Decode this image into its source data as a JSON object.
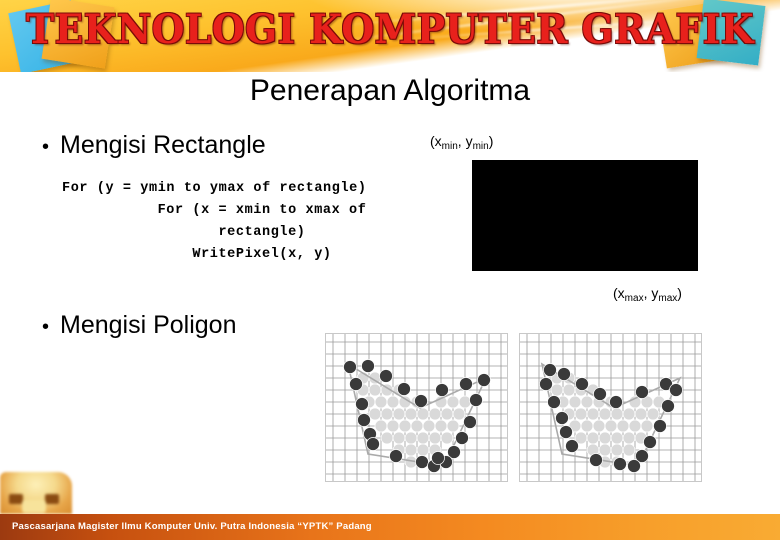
{
  "banner": {
    "title": "TEKNOLOGI KOMPUTER GRAFIK",
    "accent_red": "#e8211c",
    "accent_yellow": "#fec22e",
    "decor": [
      {
        "name": "blue-square-left",
        "color": "#43b8e8"
      },
      {
        "name": "orange-square-left",
        "color": "#f5b02c"
      },
      {
        "name": "orange-square-right",
        "color": "#f3a720"
      },
      {
        "name": "teal-square-right",
        "color": "#45b7c4"
      }
    ]
  },
  "slide": {
    "title": "Penerapan Algoritma",
    "bullets": [
      {
        "marker": "•",
        "label": "Mengisi Rectangle"
      },
      {
        "marker": "•",
        "label": "Mengisi Poligon"
      }
    ],
    "code": {
      "line1": "For (y = ymin to ymax of rectangle)",
      "line2": "For (x = xmin to xmax of",
      "line3": "rectangle)",
      "line4": "WritePixel(x, y)"
    },
    "rectangle_demo": {
      "fill_color": "#000000",
      "label_min_open": "(x",
      "label_min_sub1": "min",
      "label_min_mid": ", y",
      "label_min_sub2": "min",
      "label_min_close": ")",
      "label_max_open": "(x",
      "label_max_sub1": "max",
      "label_max_mid": ", y",
      "label_max_sub2": "max",
      "label_max_close": ")"
    },
    "polygon_figures": [
      {
        "name": "polygon-fill-figure-left",
        "grid_color": "#808080",
        "interior_pixel_color": "#d9d9d9",
        "boundary_pixel_color": "#404040"
      },
      {
        "name": "polygon-fill-figure-right",
        "grid_color": "#808080",
        "interior_pixel_color": "#d9d9d9",
        "boundary_pixel_color": "#404040"
      }
    ]
  },
  "footer": {
    "text": "Pascasarjana Magister Ilmu Komputer  Univ. Putra Indonesia “YPTK” Padang",
    "bar_color": "#ef7d1c"
  }
}
